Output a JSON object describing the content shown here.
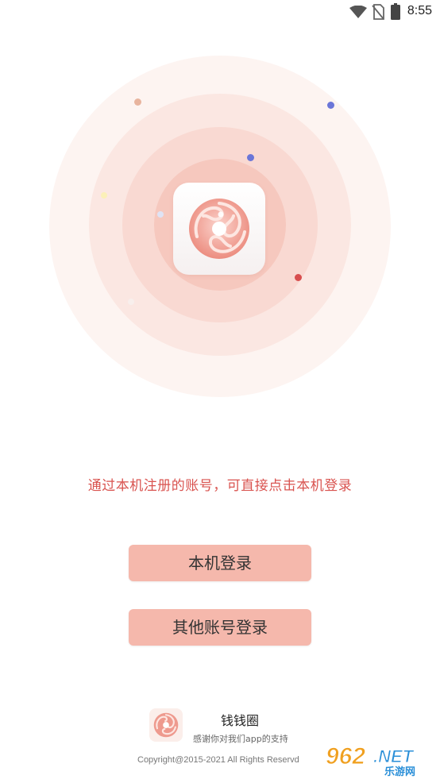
{
  "status_bar": {
    "time": "8:55",
    "icons": [
      "wifi-icon",
      "no-sim-icon",
      "battery-icon"
    ]
  },
  "hero": {
    "app_icon": "swirl-logo-icon",
    "colors": {
      "ring_outer": "#fdf4f1",
      "ring_mid": "#fbe7e2",
      "ring_inner": "#f9d9d2",
      "ring_core": "#f6c8be"
    }
  },
  "login": {
    "hint": "通过本机注册的账号，可直接点击本机登录",
    "local_login_label": "本机登录",
    "other_login_label": "其他账号登录",
    "button_color": "#f5b8ac",
    "hint_color": "#d9534f"
  },
  "footer": {
    "app_name": "钱钱圈",
    "thanks": "感谢你对我们app的支持",
    "copyright": "Copyright@2015-2021 All Rights Reservd"
  },
  "watermark": {
    "brand": "962",
    "suffix": ".NET",
    "sub": "乐游网"
  }
}
